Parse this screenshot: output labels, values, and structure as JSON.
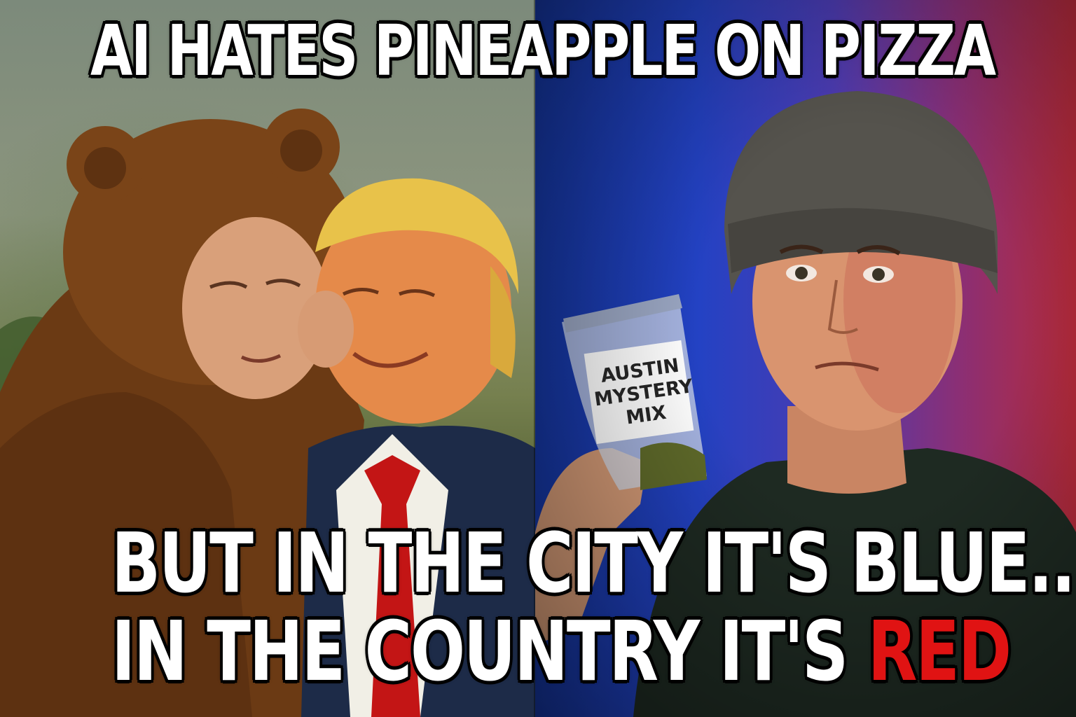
{
  "meme": {
    "top_caption": "AI HATES PINEAPPLE ON PIZZA",
    "middle_caption": "BUT IN THE CITY IT'S BLUE...",
    "bottom_caption_prefix": "IN THE COUNTRY IT'S ",
    "bottom_caption_highlight": "RED",
    "highlight_color": "#e01313"
  },
  "bag": {
    "label_line1": "AUSTIN",
    "label_line2": "MYSTERY",
    "label_line3": "MIX"
  }
}
